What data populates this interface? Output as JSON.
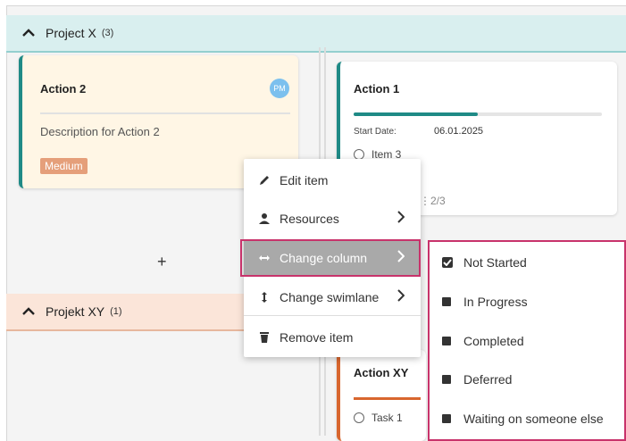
{
  "swimlanes": [
    {
      "title": "Project X",
      "count": "(3)"
    },
    {
      "title": "Projekt XY",
      "count": "(1)"
    }
  ],
  "cards": {
    "action2": {
      "title": "Action 2",
      "avatar": "PM",
      "description": "Description for Action 2",
      "priority": "Medium"
    },
    "action1": {
      "title": "Action 1",
      "progress": 0.5,
      "start_label": "Start Date:",
      "start_date": "06.01.2025",
      "item": "Item 3",
      "checklist": "2/3"
    },
    "actionxy": {
      "title": "Action XY",
      "task": "Task 1"
    }
  },
  "add_label": "+",
  "context_menu": {
    "items": [
      {
        "label": "Edit item",
        "icon": "pencil-icon"
      },
      {
        "label": "Resources",
        "icon": "person-icon",
        "submenu": true
      },
      {
        "label": "Change column",
        "icon": "horizontal-arrows-icon",
        "submenu": true,
        "highlighted": true
      },
      {
        "label": "Change swimlane",
        "icon": "vertical-arrows-icon",
        "submenu": true
      },
      {
        "label": "Remove item",
        "icon": "trash-icon"
      }
    ]
  },
  "column_submenu": {
    "items": [
      {
        "label": "Not Started",
        "checked": true
      },
      {
        "label": "In Progress"
      },
      {
        "label": "Completed"
      },
      {
        "label": "Deferred"
      },
      {
        "label": "Waiting on someone else"
      }
    ]
  },
  "colors": {
    "teal": "#1f8a86",
    "orange": "#d8662e",
    "highlight": "#c8336b"
  }
}
